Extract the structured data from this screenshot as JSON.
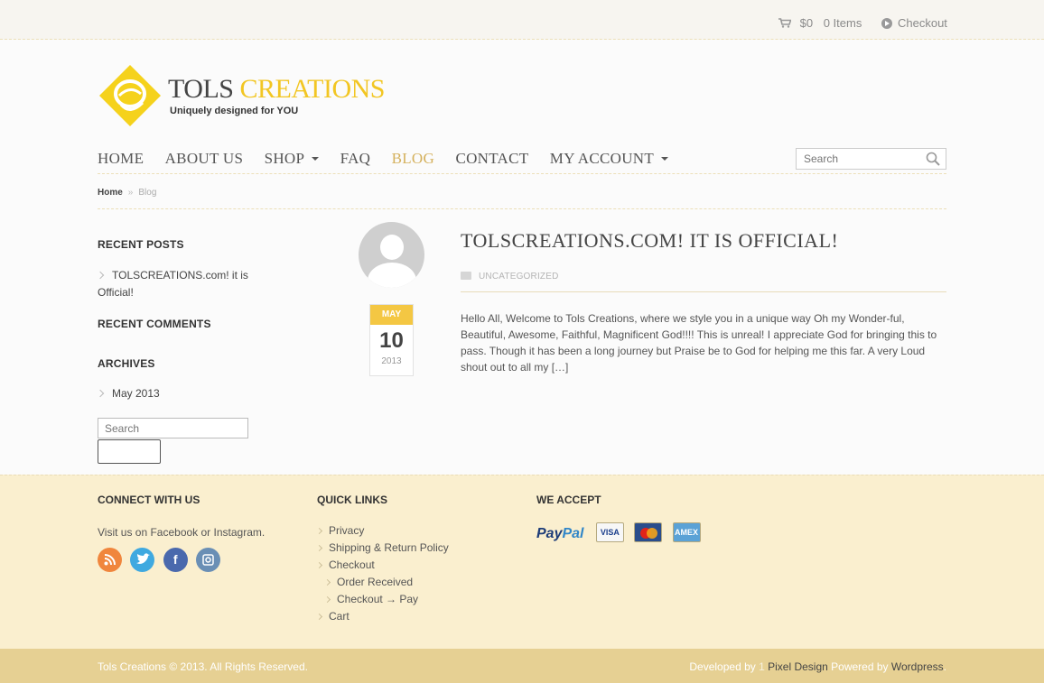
{
  "topbar": {
    "cart_amount": "$0",
    "cart_items": "0 Items",
    "checkout": "Checkout"
  },
  "logo": {
    "brand_1": "TOLS",
    "brand_2": "CREATIONS",
    "tagline": "Uniquely designed for YOU"
  },
  "nav": {
    "items": [
      {
        "label": "HOME"
      },
      {
        "label": "ABOUT US"
      },
      {
        "label": "SHOP"
      },
      {
        "label": "FAQ"
      },
      {
        "label": "BLOG"
      },
      {
        "label": "CONTACT"
      },
      {
        "label": "MY ACCOUNT"
      }
    ],
    "search_placeholder": "Search"
  },
  "breadcrumb": {
    "home": "Home",
    "separator": "»",
    "current": "Blog"
  },
  "sidebar": {
    "recent_posts_title": "RECENT POSTS",
    "recent_post": "TOLSCREATIONS.com! it is Official!",
    "recent_comments_title": "RECENT COMMENTS",
    "archives_title": "ARCHIVES",
    "archive_item": "May 2013",
    "search_placeholder": "Search"
  },
  "post": {
    "date_month": "MAY",
    "date_day": "10",
    "date_year": "2013",
    "title": "TOLSCREATIONS.COM! IT IS OFFICIAL!",
    "category": "UNCATEGORIZED",
    "excerpt": "Hello All, Welcome to Tols Creations, where we style you in a unique way Oh my Wonder-ful, Beautiful, Awesome, Faithful, Magnificent God!!!! This is unreal! I appreciate God for bringing this to pass.  Though it has been a long journey but Praise be to God for helping me this far. A very Loud shout out to all my […]"
  },
  "footer": {
    "connect_title": "CONNECT WITH US",
    "connect_text": "Visit us on Facebook or Instagram.",
    "quick_title": "QUICK LINKS",
    "links": [
      {
        "label": "Privacy"
      },
      {
        "label": "Shipping & Return Policy"
      },
      {
        "label": "Checkout"
      },
      {
        "label": "Order Received"
      },
      {
        "label": "Checkout → Pay"
      },
      {
        "label": "Cart"
      }
    ],
    "accept_title": "WE ACCEPT",
    "paypal_1": "Pay",
    "paypal_2": "Pal",
    "cards": [
      "VISA",
      "MasterCard",
      "AMEX"
    ]
  },
  "bottom": {
    "copyright": "Tols Creations © 2013. All Rights Reserved.",
    "dev_prefix": "Developed by ",
    "dev_name_1": "1",
    "dev_name_2": " Pixel Design",
    "powered_prefix": " Powered by ",
    "powered_name": "Wordpress",
    "period": "."
  },
  "colors": {
    "accent": "#f2c623",
    "active_nav": "#d5b15d",
    "footer_bg": "#faefcf",
    "bottom_bg": "#e6d093"
  }
}
